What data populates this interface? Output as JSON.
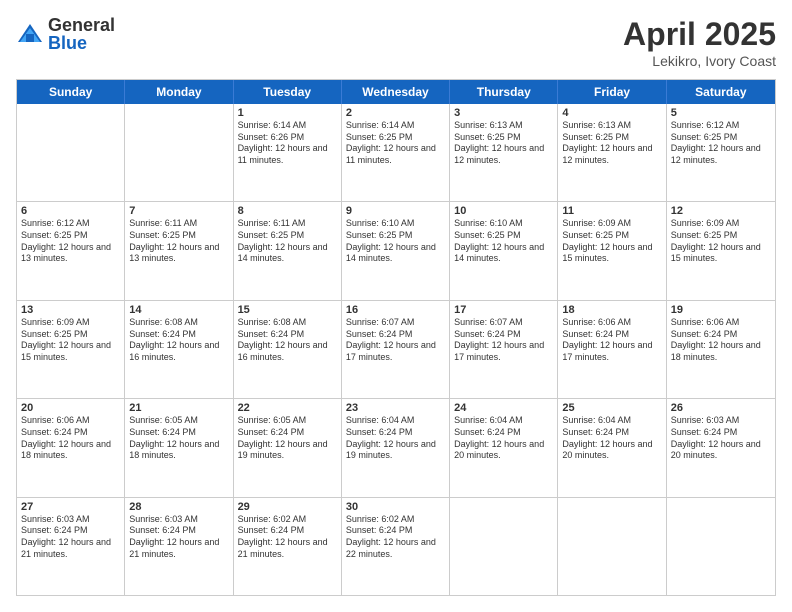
{
  "logo": {
    "general": "General",
    "blue": "Blue"
  },
  "title": "April 2025",
  "subtitle": "Lekikro, Ivory Coast",
  "header_days": [
    "Sunday",
    "Monday",
    "Tuesday",
    "Wednesday",
    "Thursday",
    "Friday",
    "Saturday"
  ],
  "weeks": [
    [
      {
        "day": "",
        "info": ""
      },
      {
        "day": "",
        "info": ""
      },
      {
        "day": "1",
        "info": "Sunrise: 6:14 AM\nSunset: 6:26 PM\nDaylight: 12 hours and 11 minutes."
      },
      {
        "day": "2",
        "info": "Sunrise: 6:14 AM\nSunset: 6:25 PM\nDaylight: 12 hours and 11 minutes."
      },
      {
        "day": "3",
        "info": "Sunrise: 6:13 AM\nSunset: 6:25 PM\nDaylight: 12 hours and 12 minutes."
      },
      {
        "day": "4",
        "info": "Sunrise: 6:13 AM\nSunset: 6:25 PM\nDaylight: 12 hours and 12 minutes."
      },
      {
        "day": "5",
        "info": "Sunrise: 6:12 AM\nSunset: 6:25 PM\nDaylight: 12 hours and 12 minutes."
      }
    ],
    [
      {
        "day": "6",
        "info": "Sunrise: 6:12 AM\nSunset: 6:25 PM\nDaylight: 12 hours and 13 minutes."
      },
      {
        "day": "7",
        "info": "Sunrise: 6:11 AM\nSunset: 6:25 PM\nDaylight: 12 hours and 13 minutes."
      },
      {
        "day": "8",
        "info": "Sunrise: 6:11 AM\nSunset: 6:25 PM\nDaylight: 12 hours and 14 minutes."
      },
      {
        "day": "9",
        "info": "Sunrise: 6:10 AM\nSunset: 6:25 PM\nDaylight: 12 hours and 14 minutes."
      },
      {
        "day": "10",
        "info": "Sunrise: 6:10 AM\nSunset: 6:25 PM\nDaylight: 12 hours and 14 minutes."
      },
      {
        "day": "11",
        "info": "Sunrise: 6:09 AM\nSunset: 6:25 PM\nDaylight: 12 hours and 15 minutes."
      },
      {
        "day": "12",
        "info": "Sunrise: 6:09 AM\nSunset: 6:25 PM\nDaylight: 12 hours and 15 minutes."
      }
    ],
    [
      {
        "day": "13",
        "info": "Sunrise: 6:09 AM\nSunset: 6:25 PM\nDaylight: 12 hours and 15 minutes."
      },
      {
        "day": "14",
        "info": "Sunrise: 6:08 AM\nSunset: 6:24 PM\nDaylight: 12 hours and 16 minutes."
      },
      {
        "day": "15",
        "info": "Sunrise: 6:08 AM\nSunset: 6:24 PM\nDaylight: 12 hours and 16 minutes."
      },
      {
        "day": "16",
        "info": "Sunrise: 6:07 AM\nSunset: 6:24 PM\nDaylight: 12 hours and 17 minutes."
      },
      {
        "day": "17",
        "info": "Sunrise: 6:07 AM\nSunset: 6:24 PM\nDaylight: 12 hours and 17 minutes."
      },
      {
        "day": "18",
        "info": "Sunrise: 6:06 AM\nSunset: 6:24 PM\nDaylight: 12 hours and 17 minutes."
      },
      {
        "day": "19",
        "info": "Sunrise: 6:06 AM\nSunset: 6:24 PM\nDaylight: 12 hours and 18 minutes."
      }
    ],
    [
      {
        "day": "20",
        "info": "Sunrise: 6:06 AM\nSunset: 6:24 PM\nDaylight: 12 hours and 18 minutes."
      },
      {
        "day": "21",
        "info": "Sunrise: 6:05 AM\nSunset: 6:24 PM\nDaylight: 12 hours and 18 minutes."
      },
      {
        "day": "22",
        "info": "Sunrise: 6:05 AM\nSunset: 6:24 PM\nDaylight: 12 hours and 19 minutes."
      },
      {
        "day": "23",
        "info": "Sunrise: 6:04 AM\nSunset: 6:24 PM\nDaylight: 12 hours and 19 minutes."
      },
      {
        "day": "24",
        "info": "Sunrise: 6:04 AM\nSunset: 6:24 PM\nDaylight: 12 hours and 20 minutes."
      },
      {
        "day": "25",
        "info": "Sunrise: 6:04 AM\nSunset: 6:24 PM\nDaylight: 12 hours and 20 minutes."
      },
      {
        "day": "26",
        "info": "Sunrise: 6:03 AM\nSunset: 6:24 PM\nDaylight: 12 hours and 20 minutes."
      }
    ],
    [
      {
        "day": "27",
        "info": "Sunrise: 6:03 AM\nSunset: 6:24 PM\nDaylight: 12 hours and 21 minutes."
      },
      {
        "day": "28",
        "info": "Sunrise: 6:03 AM\nSunset: 6:24 PM\nDaylight: 12 hours and 21 minutes."
      },
      {
        "day": "29",
        "info": "Sunrise: 6:02 AM\nSunset: 6:24 PM\nDaylight: 12 hours and 21 minutes."
      },
      {
        "day": "30",
        "info": "Sunrise: 6:02 AM\nSunset: 6:24 PM\nDaylight: 12 hours and 22 minutes."
      },
      {
        "day": "",
        "info": ""
      },
      {
        "day": "",
        "info": ""
      },
      {
        "day": "",
        "info": ""
      }
    ]
  ]
}
